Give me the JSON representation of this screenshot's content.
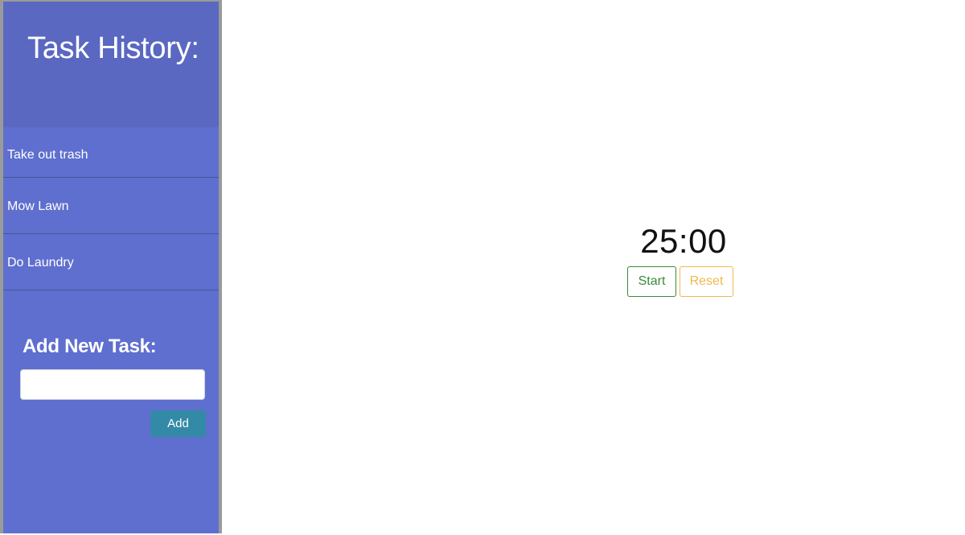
{
  "sidebar": {
    "title": "Task History:",
    "tasks": [
      {
        "label": "Take out trash"
      },
      {
        "label": "Mow Lawn"
      },
      {
        "label": "Do Laundry"
      }
    ],
    "add_section": {
      "title": "Add New Task:",
      "input_value": "",
      "input_placeholder": "",
      "add_label": "Add"
    }
  },
  "timer": {
    "display": "25:00",
    "start_label": "Start",
    "reset_label": "Reset"
  },
  "colors": {
    "sidebar_bg": "#5f6fcf",
    "sidebar_header_bg": "#5a68c2",
    "add_button_bg": "#338aa6",
    "start_color": "#3a8a3a",
    "reset_color": "#f0b94a"
  }
}
